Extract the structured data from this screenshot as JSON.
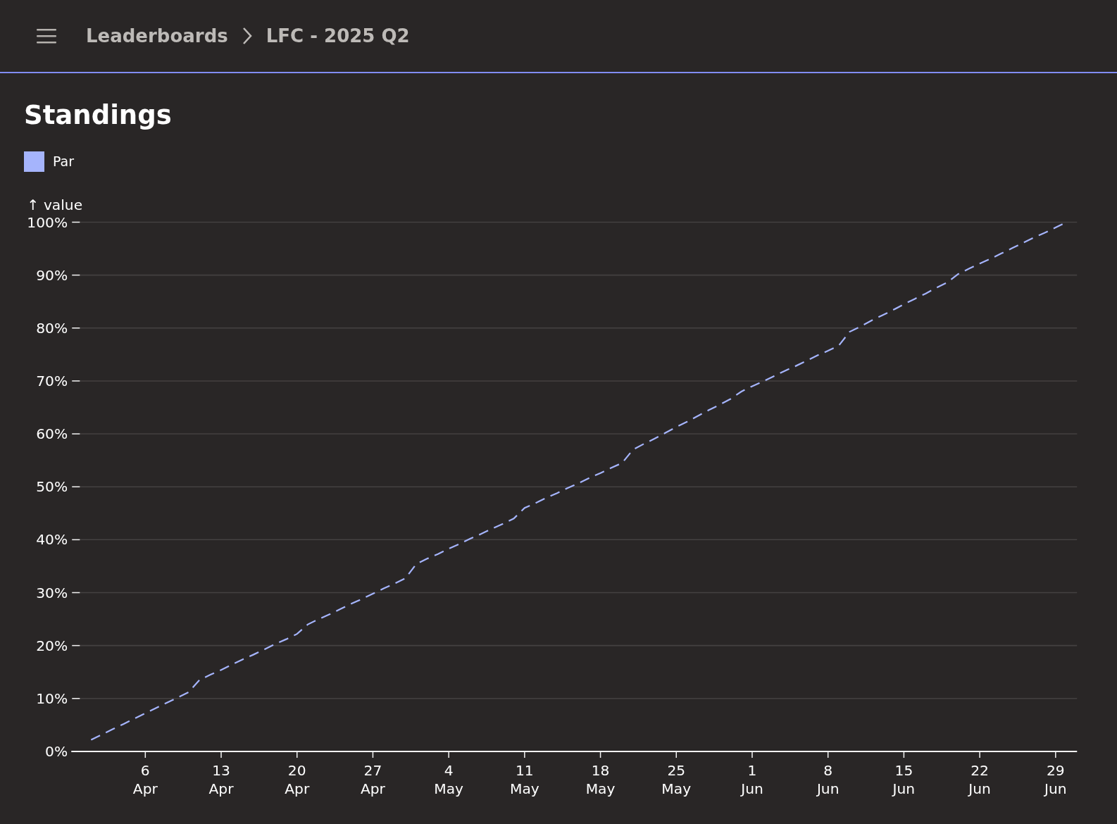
{
  "header": {
    "breadcrumbs": [
      {
        "label": "Leaderboards"
      },
      {
        "label": "LFC - 2025 Q2"
      }
    ]
  },
  "page": {
    "title": "Standings",
    "chart_data": {
      "type": "line",
      "grid": true,
      "ylabel": "↑ value",
      "ylim": [
        0,
        100
      ],
      "categories": [
        null,
        null,
        null,
        null,
        null,
        "6 Apr",
        null,
        null,
        null,
        null,
        null,
        null,
        "13 Apr",
        null,
        null,
        null,
        null,
        null,
        null,
        "20 Apr",
        null,
        null,
        null,
        null,
        null,
        null,
        "27 Apr",
        null,
        null,
        null,
        null,
        null,
        null,
        "4 May",
        null,
        null,
        null,
        null,
        null,
        null,
        "11 May",
        null,
        null,
        null,
        null,
        null,
        null,
        "18 May",
        null,
        null,
        null,
        null,
        null,
        null,
        "25 May",
        null,
        null,
        null,
        null,
        null,
        null,
        "1 Jun",
        null,
        null,
        null,
        null,
        null,
        null,
        "8 Jun",
        null,
        null,
        null,
        null,
        null,
        null,
        "15 Jun",
        null,
        null,
        null,
        null,
        null,
        null,
        "22 Jun",
        null,
        null,
        null,
        null,
        null,
        null,
        "29 Jun",
        null
      ],
      "yticks": [
        {
          "value": 0,
          "label": "0%"
        },
        {
          "value": 10,
          "label": "10%"
        },
        {
          "value": 20,
          "label": "20%"
        },
        {
          "value": 30,
          "label": "30%"
        },
        {
          "value": 40,
          "label": "40%"
        },
        {
          "value": 50,
          "label": "50%"
        },
        {
          "value": 60,
          "label": "60%"
        },
        {
          "value": 70,
          "label": "70%"
        },
        {
          "value": 80,
          "label": "80%"
        },
        {
          "value": 90,
          "label": "90%"
        },
        {
          "value": 100,
          "label": "100%"
        }
      ],
      "series": [
        {
          "name": "Par",
          "color": "#a5b4fc",
          "line_style": "dashed",
          "values": [
            2.2,
            3.2,
            4.2,
            5.2,
            6.2,
            7.2,
            8.2,
            9.2,
            10.2,
            11.2,
            13.5,
            14.5,
            15.4,
            16.4,
            17.4,
            18.3,
            19.3,
            20.3,
            21.2,
            22.2,
            24,
            25,
            25.9,
            26.9,
            27.9,
            28.8,
            29.8,
            30.8,
            31.7,
            32.7,
            35.4,
            36.4,
            37.3,
            38.3,
            39.2,
            40.2,
            41.1,
            42.1,
            43,
            44,
            46,
            46.9,
            47.9,
            48.8,
            49.8,
            50.7,
            51.7,
            52.6,
            53.6,
            54.5,
            57,
            58.1,
            59.1,
            60.2,
            61.3,
            62.3,
            63.4,
            64.5,
            65.5,
            66.6,
            68,
            69,
            69.9,
            70.9,
            71.9,
            72.8,
            73.8,
            74.8,
            75.7,
            76.7,
            79.3,
            80.3,
            81.4,
            82.4,
            83.4,
            84.5,
            85.5,
            86.5,
            87.6,
            88.6,
            90.2,
            91.2,
            92.2,
            93.1,
            94.1,
            95.1,
            96.1,
            97.1,
            98,
            99,
            100
          ]
        }
      ]
    }
  }
}
